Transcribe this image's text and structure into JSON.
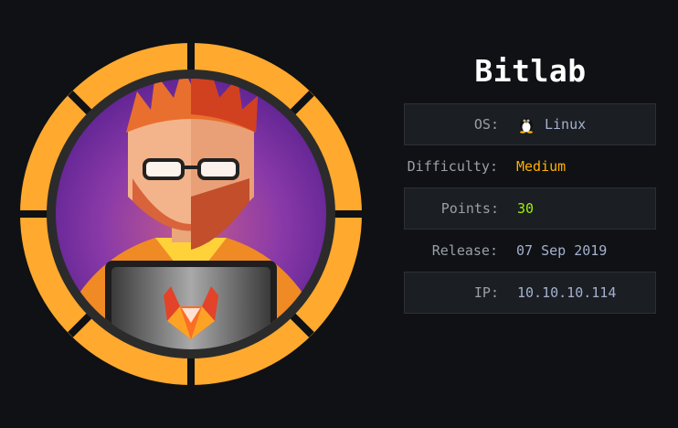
{
  "machine": {
    "name": "Bitlab"
  },
  "info": {
    "os": {
      "label": "OS:",
      "value": "Linux",
      "icon": "tux-penguin-icon"
    },
    "difficulty": {
      "label": "Difficulty:",
      "value": "Medium"
    },
    "points": {
      "label": "Points:",
      "value": "30"
    },
    "release": {
      "label": "Release:",
      "value": "07 Sep 2019"
    },
    "ip": {
      "label": "IP:",
      "value": "10.10.10.114"
    }
  },
  "colors": {
    "background": "#0f1114",
    "badge_ring": "#ffa92e",
    "badge_inner": "#6a2d9c",
    "difficulty_medium": "#ffaf00",
    "points": "#9fef00",
    "value_text": "#a4b1cd"
  }
}
